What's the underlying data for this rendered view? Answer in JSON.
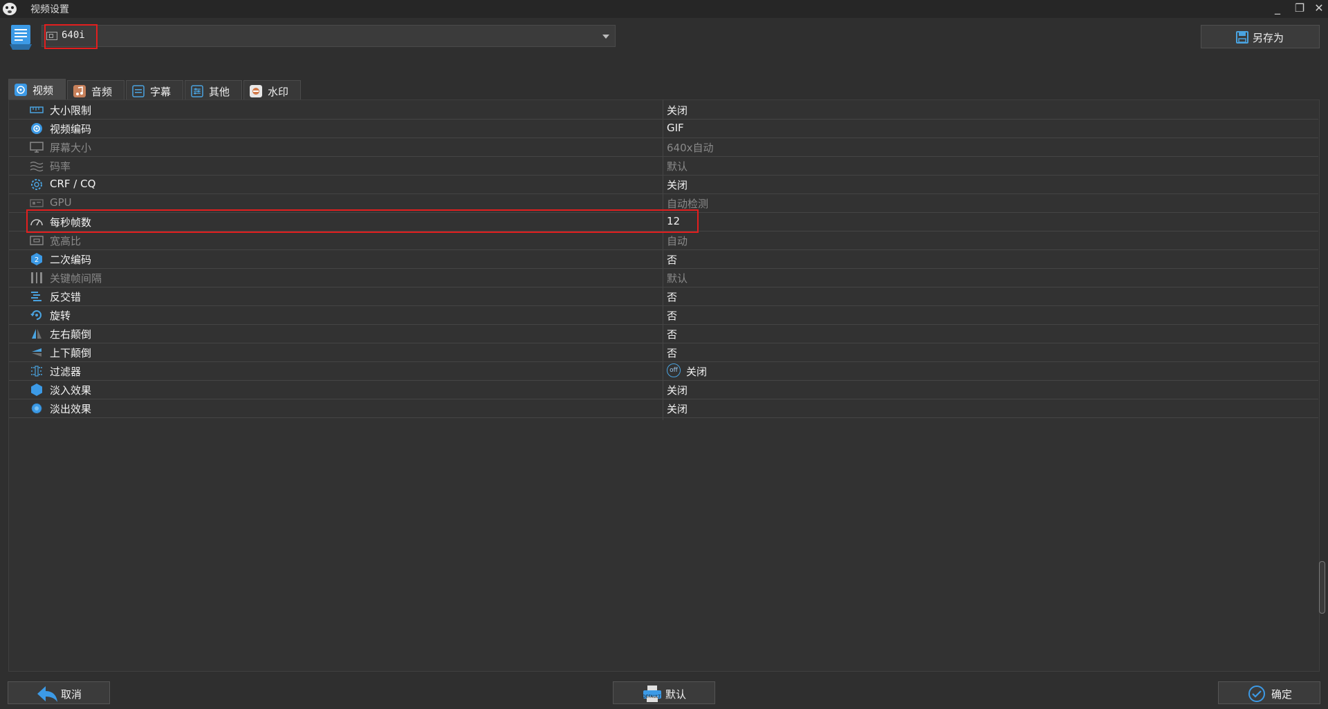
{
  "window": {
    "title": "视频设置",
    "controls": [
      "_",
      "❐",
      "✕"
    ]
  },
  "preset": {
    "value": "640i"
  },
  "toolbar": {
    "save_as_label": "另存为"
  },
  "tabs": [
    {
      "label": "视频",
      "icon": "video-icon",
      "active": true
    },
    {
      "label": "音频",
      "icon": "music-note-icon",
      "active": false
    },
    {
      "label": "字幕",
      "icon": "subtitle-icon",
      "active": false
    },
    {
      "label": "其他",
      "icon": "sliders-icon",
      "active": false
    },
    {
      "label": "水印",
      "icon": "watermark-icon",
      "active": false
    }
  ],
  "settings": [
    {
      "label": "大小限制",
      "value": "关闭",
      "icon": "ruler-icon",
      "enabled": true
    },
    {
      "label": "视频编码",
      "value": "GIF",
      "icon": "codec-icon",
      "enabled": true
    },
    {
      "label": "屏幕大小",
      "value": "640x自动",
      "icon": "monitor-icon",
      "enabled": false
    },
    {
      "label": "码率",
      "value": "默认",
      "icon": "bitrate-waves-icon",
      "enabled": false
    },
    {
      "label": "CRF / CQ",
      "value": "关闭",
      "icon": "gear-icon",
      "enabled": true
    },
    {
      "label": "GPU",
      "value": "自动检测",
      "icon": "gpu-chip-icon",
      "enabled": false
    },
    {
      "label": "每秒帧数",
      "value": "12",
      "icon": "speedometer-icon",
      "enabled": true
    },
    {
      "label": "宽高比",
      "value": "自动",
      "icon": "aspect-ratio-icon",
      "enabled": false
    },
    {
      "label": "二次编码",
      "value": "否",
      "icon": "two-pass-icon",
      "enabled": true
    },
    {
      "label": "关键帧间隔",
      "value": "默认",
      "icon": "keyframe-icon",
      "enabled": false
    },
    {
      "label": "反交错",
      "value": "否",
      "icon": "deinterlace-icon",
      "enabled": true
    },
    {
      "label": "旋转",
      "value": "否",
      "icon": "rotate-icon",
      "enabled": true
    },
    {
      "label": "左右颠倒",
      "value": "否",
      "icon": "flip-horizontal-icon",
      "enabled": true
    },
    {
      "label": "上下颠倒",
      "value": "否",
      "icon": "flip-vertical-icon",
      "enabled": true
    },
    {
      "label": "过滤器",
      "value": "关闭",
      "icon": "filter-icon",
      "enabled": true,
      "badge": "off"
    },
    {
      "label": "淡入效果",
      "value": "关闭",
      "icon": "fade-in-icon",
      "enabled": true
    },
    {
      "label": "淡出效果",
      "value": "关闭",
      "icon": "fade-out-icon",
      "enabled": true
    }
  ],
  "footer": {
    "cancel_label": "取消",
    "default_label": "默认",
    "default_icon_text": "DEFAULT",
    "ok_label": "确定"
  },
  "colors": {
    "background": "#2f2f2f",
    "accent": "#3c9ae6",
    "highlight": "#e41e1e",
    "disabled_text": "#8a8a8a"
  }
}
